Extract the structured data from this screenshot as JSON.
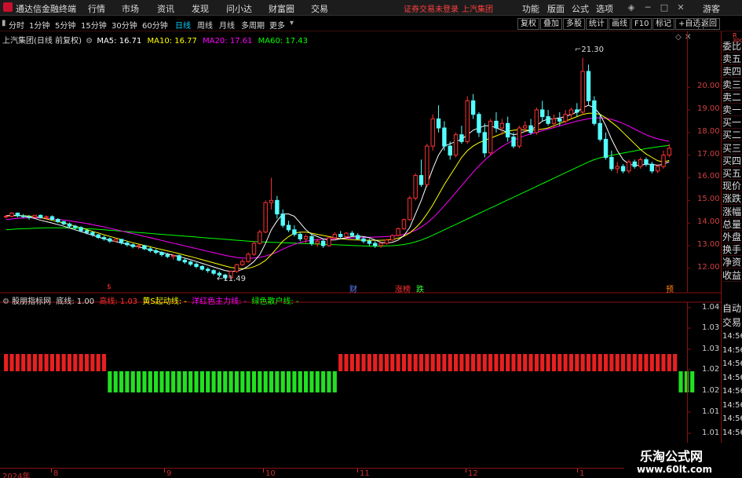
{
  "app": {
    "title": "通达信金融终端",
    "menus": [
      "行情",
      "市场",
      "资讯",
      "发现",
      "问小达",
      "财富圈",
      "交易"
    ],
    "notice": "证券交易未登录",
    "stock": "上汽集团",
    "right_menus": [
      "功能",
      "版面",
      "公式",
      "选项"
    ],
    "guest": "游客"
  },
  "toolbar": {
    "periods": [
      "分时",
      "1分钟",
      "5分钟",
      "15分钟",
      "30分钟",
      "60分钟",
      "日线",
      "周线",
      "月线",
      "多周期",
      "更多"
    ],
    "active_period": "日线",
    "right_buttons": [
      "复权",
      "叠加",
      "多股",
      "统计",
      "画线",
      "F10",
      "标记",
      "+自选",
      "返回"
    ]
  },
  "main_chart": {
    "header": {
      "name": "上汽集团(日线 前复权)",
      "ma5": "MA5: 16.71",
      "ma10": "MA10: 16.77",
      "ma20": "MA20: 17.61",
      "ma60": "MA60: 17.43"
    },
    "high_label": "21.30",
    "low_label": "11.49",
    "event_marks": [
      {
        "text": "$",
        "color": "#ff3030"
      },
      {
        "text": "财",
        "color": "#6060ff"
      },
      {
        "text": "涨榜",
        "color": "#ff3030"
      },
      {
        "text": "跌",
        "color": "#30ff30"
      },
      {
        "text": "预",
        "color": "#ff8000"
      }
    ],
    "y_ticks": [
      "20.00",
      "19.00",
      "18.00",
      "17.00",
      "16.00",
      "15.00",
      "14.00",
      "13.00",
      "12.00"
    ]
  },
  "indicator": {
    "header": {
      "name": "股朋指标网",
      "di": "底线: 1.00",
      "gao": "高线: 1.03",
      "huang": "黄S起动线: -",
      "yang": "洋红色主力线: -",
      "lv": "绿色散户线: -"
    },
    "y_ticks": [
      "1.04",
      "1.03",
      "1.03",
      "1.02",
      "1.02",
      "1.01",
      "1.01"
    ]
  },
  "sidebar": {
    "items": [
      "委比",
      "卖五",
      "卖四",
      "卖三",
      "卖二",
      "卖一",
      "买一",
      "买二",
      "买三",
      "买四",
      "买五",
      "现价",
      "涨跌",
      "涨幅",
      "总量",
      "外盘",
      "换手",
      "净资",
      "收益"
    ],
    "top": "R",
    "sub": "300"
  },
  "sidebar2": {
    "items": [
      "自动",
      "交易",
      "14:56",
      "14:56",
      "14:56",
      "14:56",
      "14:56",
      "14:56",
      "14:56",
      "14:56"
    ]
  },
  "x_axis": {
    "ticks": [
      "2024年",
      "8",
      "9",
      "10",
      "11",
      "12",
      "1"
    ]
  },
  "watermark": {
    "line1": "乐淘公式网",
    "line2": "www.60lt.com"
  },
  "colors": {
    "up": "#ff3333",
    "down": "#54ffff",
    "ma5": "#ffffff",
    "ma10": "#ffff00",
    "ma20": "#ff00ff",
    "ma60": "#00ff00",
    "bg": "#000000",
    "grid": "#8a1010"
  },
  "chart_data": {
    "type": "candlestick",
    "ylim": [
      11.3,
      21.6
    ],
    "ohlc": [
      [
        14.3,
        14.35,
        14.2,
        14.3
      ],
      [
        14.3,
        14.48,
        14.25,
        14.44
      ],
      [
        14.44,
        14.46,
        14.25,
        14.32
      ],
      [
        14.32,
        14.4,
        14.22,
        14.28
      ],
      [
        14.28,
        14.35,
        14.15,
        14.26
      ],
      [
        14.26,
        14.36,
        14.22,
        14.34
      ],
      [
        14.34,
        14.38,
        14.2,
        14.24
      ],
      [
        14.24,
        14.33,
        14.15,
        14.28
      ],
      [
        14.28,
        14.34,
        14.12,
        14.16
      ],
      [
        14.16,
        14.22,
        14.0,
        14.06
      ],
      [
        14.06,
        14.1,
        13.9,
        13.96
      ],
      [
        13.96,
        14.02,
        13.78,
        13.86
      ],
      [
        13.86,
        13.92,
        13.72,
        13.8
      ],
      [
        13.8,
        13.86,
        13.6,
        13.66
      ],
      [
        13.66,
        13.72,
        13.5,
        13.58
      ],
      [
        13.58,
        13.66,
        13.4,
        13.48
      ],
      [
        13.48,
        13.52,
        13.3,
        13.36
      ],
      [
        13.36,
        13.44,
        13.22,
        13.3
      ],
      [
        13.3,
        13.36,
        13.12,
        13.2
      ],
      [
        13.2,
        13.32,
        13.15,
        13.28
      ],
      [
        13.28,
        13.3,
        13.05,
        13.12
      ],
      [
        13.12,
        13.2,
        12.96,
        13.04
      ],
      [
        13.04,
        13.1,
        12.88,
        12.96
      ],
      [
        12.96,
        13.06,
        12.85,
        13.0
      ],
      [
        13.0,
        13.04,
        12.8,
        12.86
      ],
      [
        12.86,
        12.94,
        12.7,
        12.78
      ],
      [
        12.78,
        12.86,
        12.62,
        12.7
      ],
      [
        12.7,
        12.76,
        12.52,
        12.6
      ],
      [
        12.6,
        12.68,
        12.45,
        12.52
      ],
      [
        12.52,
        12.62,
        12.38,
        12.56
      ],
      [
        12.56,
        12.6,
        12.3,
        12.36
      ],
      [
        12.36,
        12.44,
        12.2,
        12.28
      ],
      [
        12.28,
        12.34,
        12.1,
        12.18
      ],
      [
        12.18,
        12.26,
        12.0,
        12.08
      ],
      [
        12.08,
        12.14,
        11.9,
        11.96
      ],
      [
        11.96,
        12.04,
        11.8,
        11.9
      ],
      [
        11.9,
        11.96,
        11.7,
        11.78
      ],
      [
        11.78,
        11.86,
        11.6,
        11.7
      ],
      [
        11.7,
        11.76,
        11.49,
        11.58
      ],
      [
        11.58,
        11.9,
        11.55,
        11.86
      ],
      [
        11.86,
        12.2,
        11.8,
        12.16
      ],
      [
        12.16,
        12.4,
        12.1,
        12.3
      ],
      [
        12.3,
        12.7,
        12.25,
        12.62
      ],
      [
        12.62,
        13.2,
        12.55,
        13.1
      ],
      [
        13.1,
        13.7,
        13.05,
        13.6
      ],
      [
        13.6,
        15.0,
        13.55,
        14.9
      ],
      [
        14.9,
        16.0,
        14.6,
        15.0
      ],
      [
        15.0,
        15.2,
        14.2,
        14.4
      ],
      [
        14.4,
        14.6,
        13.8,
        13.9
      ],
      [
        13.9,
        14.1,
        13.6,
        13.7
      ],
      [
        13.7,
        13.9,
        13.4,
        13.5
      ],
      [
        13.5,
        13.6,
        13.2,
        13.3
      ],
      [
        13.3,
        13.5,
        13.1,
        13.4
      ],
      [
        13.4,
        13.5,
        13.0,
        13.1
      ],
      [
        13.1,
        13.3,
        12.95,
        13.2
      ],
      [
        13.2,
        13.3,
        12.9,
        13.0
      ],
      [
        13.0,
        13.4,
        12.95,
        13.35
      ],
      [
        13.35,
        13.6,
        13.25,
        13.5
      ],
      [
        13.5,
        13.65,
        13.3,
        13.4
      ],
      [
        13.4,
        13.6,
        13.35,
        13.55
      ],
      [
        13.55,
        13.65,
        13.4,
        13.45
      ],
      [
        13.45,
        13.55,
        13.25,
        13.3
      ],
      [
        13.3,
        13.4,
        13.1,
        13.2
      ],
      [
        13.2,
        13.3,
        13.0,
        13.1
      ],
      [
        13.1,
        13.2,
        12.9,
        13.0
      ],
      [
        13.0,
        13.15,
        12.9,
        13.1
      ],
      [
        13.1,
        13.3,
        13.05,
        13.25
      ],
      [
        13.25,
        13.5,
        13.2,
        13.45
      ],
      [
        13.45,
        13.8,
        13.4,
        13.75
      ],
      [
        13.75,
        14.2,
        13.7,
        14.15
      ],
      [
        14.15,
        15.2,
        14.1,
        15.1
      ],
      [
        15.1,
        16.2,
        15.0,
        16.1
      ],
      [
        16.1,
        16.8,
        15.6,
        15.7
      ],
      [
        15.7,
        17.5,
        15.6,
        17.4
      ],
      [
        17.4,
        18.8,
        17.2,
        18.6
      ],
      [
        18.6,
        19.2,
        18.0,
        18.2
      ],
      [
        18.2,
        18.5,
        17.2,
        17.4
      ],
      [
        17.4,
        17.6,
        16.8,
        17.0
      ],
      [
        17.0,
        18.0,
        16.9,
        17.9
      ],
      [
        17.9,
        18.3,
        17.5,
        17.6
      ],
      [
        17.6,
        19.6,
        17.5,
        19.4
      ],
      [
        19.4,
        19.7,
        18.6,
        18.8
      ],
      [
        18.8,
        18.9,
        17.8,
        18.0
      ],
      [
        18.0,
        18.4,
        16.9,
        17.1
      ],
      [
        17.1,
        18.6,
        17.0,
        18.5
      ],
      [
        18.5,
        18.9,
        18.0,
        18.2
      ],
      [
        18.2,
        18.6,
        17.9,
        18.4
      ],
      [
        18.4,
        18.7,
        17.6,
        17.8
      ],
      [
        17.8,
        18.0,
        17.3,
        17.4
      ],
      [
        17.4,
        18.3,
        17.3,
        18.2
      ],
      [
        18.2,
        18.5,
        18.0,
        18.3
      ],
      [
        18.3,
        18.6,
        17.9,
        18.0
      ],
      [
        18.0,
        19.1,
        17.9,
        19.0
      ],
      [
        19.0,
        19.4,
        18.5,
        18.7
      ],
      [
        18.7,
        19.0,
        18.3,
        18.4
      ],
      [
        18.4,
        18.8,
        18.2,
        18.6
      ],
      [
        18.6,
        18.9,
        18.3,
        18.5
      ],
      [
        18.5,
        19.0,
        18.4,
        18.8
      ],
      [
        18.8,
        19.1,
        18.6,
        19.0
      ],
      [
        19.0,
        19.3,
        18.7,
        18.9
      ],
      [
        18.9,
        21.3,
        18.8,
        20.7
      ],
      [
        20.7,
        21.0,
        19.2,
        19.4
      ],
      [
        19.4,
        19.6,
        18.3,
        18.4
      ],
      [
        18.4,
        18.8,
        17.6,
        17.7
      ],
      [
        17.7,
        18.0,
        16.8,
        16.9
      ],
      [
        16.9,
        17.2,
        16.3,
        16.4
      ],
      [
        16.4,
        16.7,
        16.2,
        16.5
      ],
      [
        16.5,
        16.6,
        16.2,
        16.3
      ],
      [
        16.3,
        16.8,
        16.2,
        16.7
      ],
      [
        16.7,
        16.8,
        16.4,
        16.5
      ],
      [
        16.5,
        16.9,
        16.4,
        16.8
      ],
      [
        16.8,
        16.9,
        16.5,
        16.6
      ],
      [
        16.6,
        16.7,
        16.2,
        16.3
      ],
      [
        16.3,
        16.6,
        16.2,
        16.5
      ],
      [
        16.5,
        17.2,
        16.4,
        17.0
      ],
      [
        17.0,
        17.5,
        16.9,
        17.3
      ]
    ],
    "ma5": [
      14.32,
      14.33,
      14.34,
      14.3,
      14.26,
      14.2,
      14.12,
      14.06,
      14.0,
      13.93,
      13.86,
      13.78,
      13.7,
      13.62,
      13.54,
      13.46,
      13.38,
      13.3,
      13.24,
      13.18,
      13.12,
      13.06,
      13.0,
      12.94,
      12.88,
      12.82,
      12.76,
      12.7,
      12.64,
      12.58,
      12.52,
      12.45,
      12.38,
      12.3,
      12.22,
      12.14,
      12.06,
      11.98,
      11.9,
      11.86,
      11.88,
      11.95,
      12.1,
      12.3,
      12.6,
      13.1,
      13.7,
      14.1,
      14.4,
      14.4,
      14.3,
      14.0,
      13.7,
      13.5,
      13.4,
      13.3,
      13.25,
      13.25,
      13.3,
      13.35,
      13.4,
      13.42,
      13.4,
      13.35,
      13.25,
      13.15,
      13.12,
      13.15,
      13.25,
      13.45,
      13.8,
      14.4,
      15.0,
      15.7,
      16.4,
      17.0,
      17.4,
      17.5,
      17.6,
      17.7,
      17.9,
      18.1,
      18.2,
      18.3,
      18.3,
      18.2,
      18.1,
      18.0,
      17.9,
      17.95,
      18.05,
      18.1,
      18.3,
      18.5,
      18.6,
      18.6,
      18.65,
      18.7,
      18.8,
      18.9,
      19.1,
      19.2,
      19.1,
      18.8,
      18.3,
      17.7,
      17.2,
      16.8,
      16.6,
      16.55,
      16.55,
      16.6,
      16.6,
      16.55,
      16.6,
      16.71
    ],
    "ma10": [
      14.32,
      14.32,
      14.33,
      14.32,
      14.31,
      14.28,
      14.24,
      14.18,
      14.12,
      14.06,
      14.0,
      13.94,
      13.86,
      13.79,
      13.71,
      13.63,
      13.56,
      13.48,
      13.41,
      13.34,
      13.27,
      13.2,
      13.13,
      13.07,
      13.01,
      12.95,
      12.89,
      12.83,
      12.77,
      12.71,
      12.65,
      12.58,
      12.52,
      12.45,
      12.38,
      12.31,
      12.24,
      12.17,
      12.1,
      12.04,
      12.0,
      11.98,
      12.0,
      12.07,
      12.18,
      12.35,
      12.6,
      12.9,
      13.2,
      13.4,
      13.55,
      13.6,
      13.6,
      13.55,
      13.5,
      13.45,
      13.4,
      13.35,
      13.3,
      13.28,
      13.26,
      13.25,
      13.24,
      13.24,
      13.24,
      13.24,
      13.25,
      13.28,
      13.33,
      13.42,
      13.56,
      13.78,
      14.05,
      14.4,
      14.8,
      15.25,
      15.7,
      16.1,
      16.5,
      16.9,
      17.2,
      17.4,
      17.55,
      17.65,
      17.75,
      17.85,
      17.95,
      18.05,
      18.1,
      18.12,
      18.1,
      18.1,
      18.12,
      18.15,
      18.2,
      18.3,
      18.4,
      18.5,
      18.6,
      18.7,
      18.8,
      18.85,
      18.85,
      18.8,
      18.65,
      18.45,
      18.25,
      18.0,
      17.75,
      17.5,
      17.25,
      17.05,
      16.9,
      16.75,
      16.7,
      16.77
    ],
    "ma20": [
      14.15,
      14.18,
      14.21,
      14.22,
      14.23,
      14.23,
      14.22,
      14.2,
      14.18,
      14.16,
      14.13,
      14.1,
      14.06,
      14.02,
      13.98,
      13.93,
      13.88,
      13.83,
      13.77,
      13.71,
      13.65,
      13.59,
      13.53,
      13.47,
      13.41,
      13.35,
      13.29,
      13.23,
      13.17,
      13.11,
      13.05,
      12.99,
      12.93,
      12.87,
      12.81,
      12.75,
      12.69,
      12.63,
      12.57,
      12.52,
      12.48,
      12.45,
      12.44,
      12.45,
      12.48,
      12.54,
      12.62,
      12.72,
      12.84,
      12.96,
      13.06,
      13.14,
      13.2,
      13.24,
      13.27,
      13.29,
      13.3,
      13.31,
      13.32,
      13.33,
      13.34,
      13.35,
      13.36,
      13.37,
      13.38,
      13.39,
      13.4,
      13.42,
      13.45,
      13.5,
      13.58,
      13.68,
      13.82,
      14.0,
      14.22,
      14.48,
      14.76,
      15.05,
      15.35,
      15.65,
      15.95,
      16.25,
      16.52,
      16.78,
      17.0,
      17.2,
      17.38,
      17.53,
      17.66,
      17.77,
      17.86,
      17.94,
      18.01,
      18.08,
      18.15,
      18.22,
      18.29,
      18.36,
      18.43,
      18.5,
      18.56,
      18.61,
      18.64,
      18.65,
      18.63,
      18.58,
      18.5,
      18.4,
      18.28,
      18.15,
      18.02,
      17.9,
      17.8,
      17.72,
      17.66,
      17.61
    ],
    "ma60": [
      13.7,
      13.72,
      13.74,
      13.75,
      13.76,
      13.77,
      13.78,
      13.79,
      13.79,
      13.79,
      13.79,
      13.78,
      13.77,
      13.76,
      13.75,
      13.74,
      13.72,
      13.7,
      13.68,
      13.66,
      13.64,
      13.62,
      13.6,
      13.58,
      13.56,
      13.54,
      13.52,
      13.5,
      13.48,
      13.46,
      13.44,
      13.42,
      13.4,
      13.38,
      13.36,
      13.34,
      13.32,
      13.3,
      13.28,
      13.26,
      13.24,
      13.22,
      13.2,
      13.18,
      13.17,
      13.16,
      13.15,
      13.14,
      13.13,
      13.12,
      13.11,
      13.1,
      13.09,
      13.08,
      13.07,
      13.06,
      13.05,
      13.04,
      13.03,
      13.02,
      13.01,
      13.0,
      12.99,
      12.98,
      12.98,
      12.98,
      12.99,
      13.0,
      13.02,
      13.05,
      13.1,
      13.17,
      13.25,
      13.35,
      13.46,
      13.58,
      13.7,
      13.82,
      13.94,
      14.06,
      14.18,
      14.3,
      14.42,
      14.54,
      14.66,
      14.78,
      14.9,
      15.02,
      15.14,
      15.26,
      15.38,
      15.5,
      15.62,
      15.74,
      15.86,
      15.98,
      16.1,
      16.22,
      16.34,
      16.46,
      16.58,
      16.7,
      16.8,
      16.88,
      16.94,
      16.99,
      17.04,
      17.09,
      17.14,
      17.19,
      17.24,
      17.29,
      17.33,
      17.37,
      17.4,
      17.43
    ],
    "signal": [
      "red",
      "red",
      "red",
      "red",
      "red",
      "red",
      "red",
      "red",
      "red",
      "red",
      "red",
      "red",
      "red",
      "red",
      "red",
      "red",
      "red",
      "red",
      "green",
      "green",
      "green",
      "green",
      "green",
      "green",
      "green",
      "green",
      "green",
      "green",
      "green",
      "green",
      "green",
      "green",
      "green",
      "green",
      "green",
      "green",
      "green",
      "green",
      "green",
      "green",
      "green",
      "green",
      "green",
      "green",
      "green",
      "green",
      "green",
      "green",
      "green",
      "green",
      "green",
      "green",
      "green",
      "green",
      "green",
      "green",
      "green",
      "green",
      "red",
      "red",
      "red",
      "red",
      "red",
      "red",
      "red",
      "red",
      "red",
      "red",
      "red",
      "red",
      "red",
      "red",
      "red",
      "red",
      "red",
      "red",
      "red",
      "red",
      "red",
      "red",
      "red",
      "red",
      "red",
      "red",
      "red",
      "red",
      "red",
      "red",
      "red",
      "red",
      "red",
      "red",
      "red",
      "red",
      "red",
      "red",
      "red",
      "red",
      "red",
      "red",
      "red",
      "red",
      "red",
      "red",
      "red",
      "red",
      "red",
      "red",
      "red",
      "red",
      "red",
      "red",
      "red",
      "red",
      "red",
      "red",
      "red",
      "green",
      "green",
      "green"
    ]
  }
}
